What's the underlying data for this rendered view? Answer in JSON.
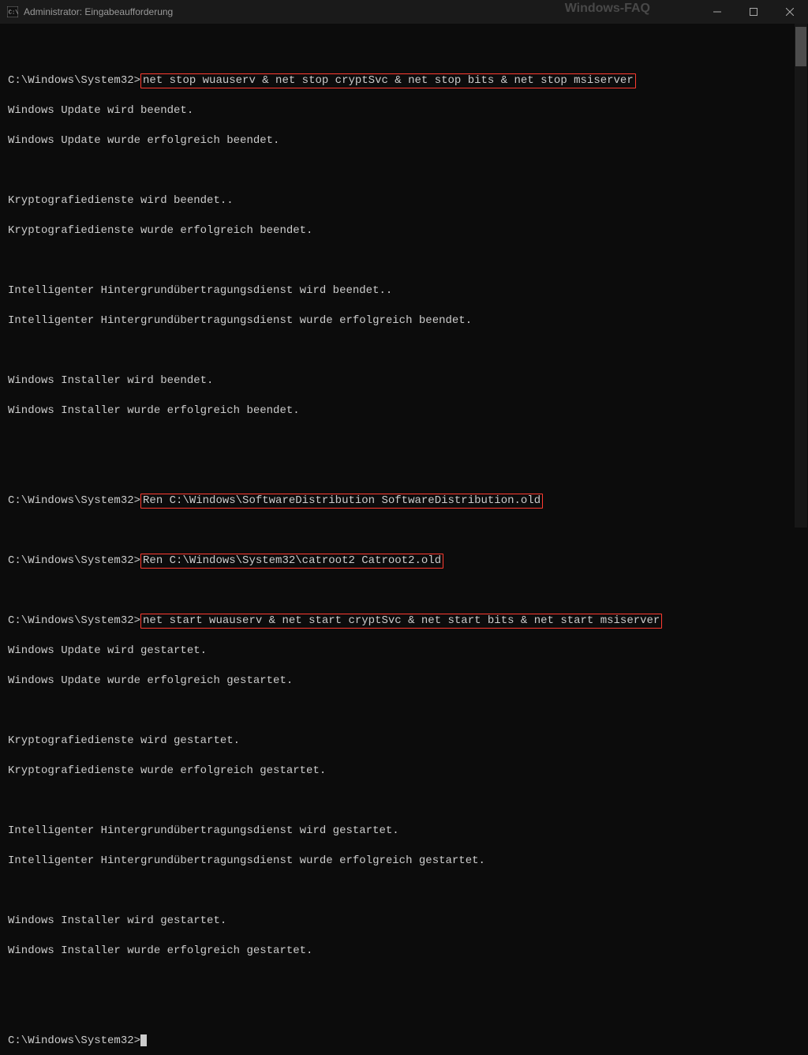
{
  "window": {
    "title": "Administrator: Eingabeaufforderung"
  },
  "watermark": "Windows-FAQ",
  "prompt": "C:\\Windows\\System32>",
  "commands": {
    "cmd1": "net stop wuauserv & net stop cryptSvc & net stop bits & net stop msiserver",
    "cmd2": "Ren C:\\Windows\\SoftwareDistribution SoftwareDistribution.old",
    "cmd3": "Ren C:\\Windows\\System32\\catroot2 Catroot2.old",
    "cmd4": "net start wuauserv & net start cryptSvc & net start bits & net start msiserver"
  },
  "output": {
    "o01": "Windows Update wird beendet.",
    "o02": "Windows Update wurde erfolgreich beendet.",
    "o03": "Kryptografiedienste wird beendet..",
    "o04": "Kryptografiedienste wurde erfolgreich beendet.",
    "o05": "Intelligenter Hintergrundübertragungsdienst wird beendet..",
    "o06": "Intelligenter Hintergrundübertragungsdienst wurde erfolgreich beendet.",
    "o07": "Windows Installer wird beendet.",
    "o08": "Windows Installer wurde erfolgreich beendet.",
    "o09": "Windows Update wird gestartet.",
    "o10": "Windows Update wurde erfolgreich gestartet.",
    "o11": "Kryptografiedienste wird gestartet.",
    "o12": "Kryptografiedienste wurde erfolgreich gestartet.",
    "o13": "Intelligenter Hintergrundübertragungsdienst wird gestartet.",
    "o14": "Intelligenter Hintergrundübertragungsdienst wurde erfolgreich gestartet.",
    "o15": "Windows Installer wird gestartet.",
    "o16": "Windows Installer wurde erfolgreich gestartet."
  },
  "blank": " "
}
